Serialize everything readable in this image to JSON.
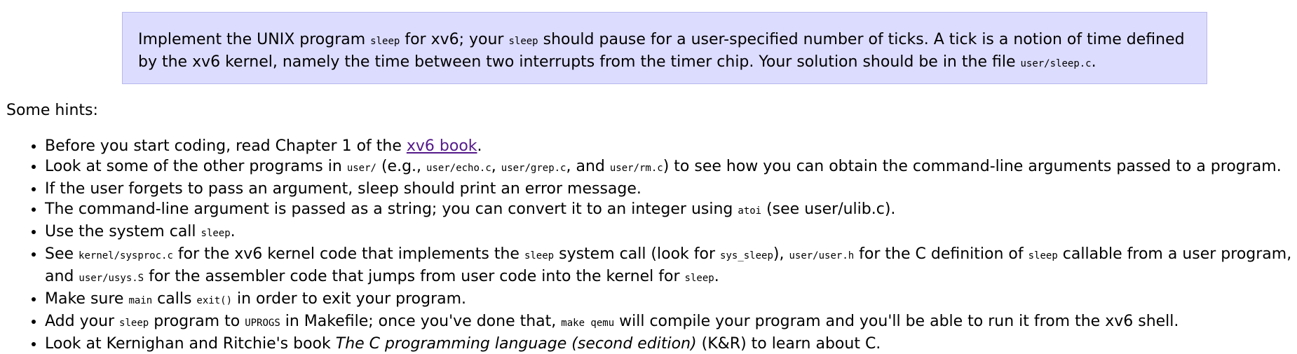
{
  "assignment": {
    "t1": "Implement the UNIX program ",
    "c1": "sleep",
    "t2": " for xv6; your ",
    "c2": "sleep",
    "t3": " should pause for a user-specified number of ticks. A tick is a notion of time defined by the xv6 kernel, namely the time between two interrupts from the timer chip. Your solution should be in the file ",
    "c3": "user/sleep.c",
    "t4": "."
  },
  "hints_heading": "Some hints:",
  "hints": [
    {
      "t1": "Before you start coding, read Chapter 1 of the ",
      "link": "xv6 book",
      "t2": "."
    },
    {
      "t1": "Look at some of the other programs in ",
      "c1": "user/",
      "t2": " (e.g., ",
      "c2": "user/echo.c",
      "t3": ", ",
      "c3": "user/grep.c",
      "t4": ", and ",
      "c4": "user/rm.c",
      "t5": ") to see how you can obtain the command-line arguments passed to a program."
    },
    {
      "t1": "If the user forgets to pass an argument, sleep should print an error message."
    },
    {
      "t1": "The command-line argument is passed as a string; you can convert it to an integer using ",
      "c1": "atoi",
      "t2": " (see user/ulib.c)."
    },
    {
      "t1": "Use the system call ",
      "c1": "sleep",
      "t2": "."
    },
    {
      "t1": "See ",
      "c1": "kernel/sysproc.c",
      "t2": " for the xv6 kernel code that implements the ",
      "c2": "sleep",
      "t3": " system call (look for ",
      "c3": "sys_sleep",
      "t4": "), ",
      "c4": "user/user.h",
      "t5": " for the C definition of ",
      "c5": "sleep",
      "t6": " callable from a user program, and ",
      "c6": "user/usys.S",
      "t7": " for the assembler code that jumps from user code into the kernel for ",
      "c7": "sleep",
      "t8": "."
    },
    {
      "t1": "Make sure ",
      "c1": "main",
      "t2": " calls ",
      "c2": "exit()",
      "t3": " in order to exit your program."
    },
    {
      "t1": "Add your ",
      "c1": "sleep",
      "t2": " program to ",
      "c2": "UPROGS",
      "t3": " in Makefile; once you've done that, ",
      "c3": "make qemu",
      "t4": " will compile your program and you'll be able to run it from the xv6 shell."
    },
    {
      "t1": "Look at Kernighan and Ritchie's book ",
      "em": "The C programming language (second edition)",
      "t2": " (K&R) to learn about C."
    }
  ],
  "colors": {
    "box_background": "#dcdcff",
    "box_border": "#b8b8ee",
    "visited_link": "#551a8b"
  }
}
